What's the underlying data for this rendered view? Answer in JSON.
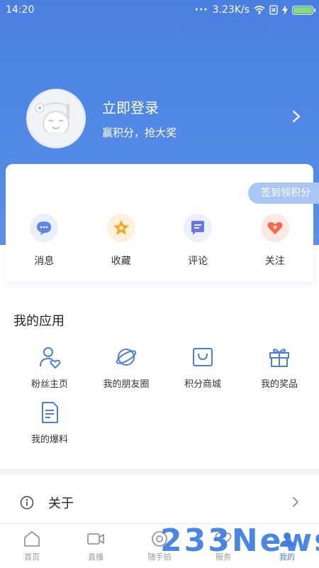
{
  "status_bar": {
    "time": "14:20",
    "network_speed": "3.23K/s"
  },
  "profile": {
    "login_title": "立即登录",
    "login_subtitle": "赢积分，抢大奖"
  },
  "card": {
    "checkin_label": "签到领积分",
    "items": [
      {
        "label": "消息",
        "icon": "message-icon",
        "color": "#4a7fe0"
      },
      {
        "label": "收藏",
        "icon": "star-icon",
        "color": "#f5a623"
      },
      {
        "label": "评论",
        "icon": "comment-icon",
        "color": "#5b6fe0"
      },
      {
        "label": "关注",
        "icon": "heart-icon",
        "color": "#f26b4f"
      }
    ]
  },
  "apps": {
    "title": "我的应用",
    "items": [
      {
        "label": "粉丝主页",
        "icon": "fans-home-icon"
      },
      {
        "label": "我的朋友圈",
        "icon": "planet-icon"
      },
      {
        "label": "积分商城",
        "icon": "shopping-bag-icon"
      },
      {
        "label": "我的奖品",
        "icon": "gift-icon"
      },
      {
        "label": "我的爆料",
        "icon": "document-icon"
      }
    ]
  },
  "about": {
    "label": "关于"
  },
  "tabbar": {
    "items": [
      {
        "label": "首页",
        "icon": "home-icon"
      },
      {
        "label": "直播",
        "icon": "video-icon"
      },
      {
        "label": "随手拍",
        "icon": "camera-icon"
      },
      {
        "label": "服务",
        "icon": "service-icon"
      },
      {
        "label": "我的",
        "icon": "user-icon",
        "active": true
      }
    ]
  },
  "watermark": "233News",
  "colors": {
    "brand": "#4a7fe0",
    "checkin": "#a9c6f4"
  }
}
